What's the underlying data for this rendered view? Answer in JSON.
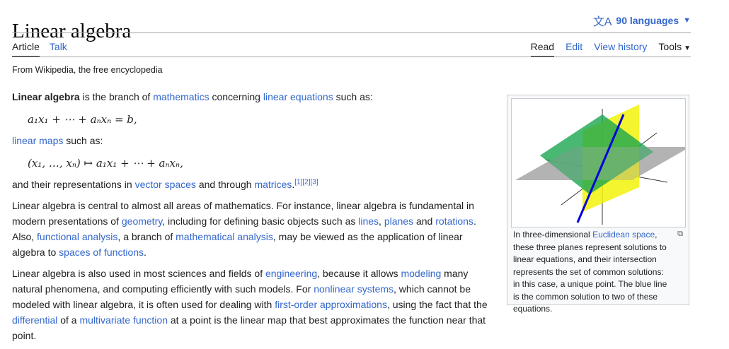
{
  "page": {
    "title": "Linear algebra",
    "languages_label": "90 languages",
    "tagline": "From Wikipedia, the free encyclopedia"
  },
  "tabs": {
    "article": "Article",
    "talk": "Talk",
    "read": "Read",
    "edit": "Edit",
    "view_history": "View history",
    "tools": "Tools"
  },
  "content": {
    "p1": {
      "bold": "Linear algebra",
      "t1": " is the branch of ",
      "l1": "mathematics",
      "t2": " concerning ",
      "l2": "linear equations",
      "t3": " such as:"
    },
    "math1": "a₁x₁ + ⋯ + aₙxₙ = b,",
    "p2": {
      "l1": "linear maps",
      "t1": " such as:"
    },
    "math2": "(x₁, …, xₙ) ↦ a₁x₁ + ⋯ + aₙxₙ,",
    "p3": {
      "t1": "and their representations in ",
      "l1": "vector spaces",
      "t2": " and through ",
      "l2": "matrices",
      "t3": ".",
      "refs": "[1][2][3]"
    },
    "p4": {
      "t1": "Linear algebra is central to almost all areas of mathematics. For instance, linear algebra is fundamental in modern presentations of ",
      "l1": "geometry",
      "t2": ", including for defining basic objects such as ",
      "l2": "lines",
      "t3": ", ",
      "l3": "planes",
      "t4": " and ",
      "l4": "rotations",
      "t5": ". Also, ",
      "l5": "functional analysis",
      "t6": ", a branch of ",
      "l6": "mathematical analysis",
      "t7": ", may be viewed as the application of linear algebra to ",
      "l7": "spaces of functions",
      "t8": "."
    },
    "p5": {
      "t1": "Linear algebra is also used in most sciences and fields of ",
      "l1": "engineering",
      "t2": ", because it allows ",
      "l2": "modeling",
      "t3": " many natural phenomena, and computing efficiently with such models. For ",
      "l3": "nonlinear systems",
      "t4": ", which cannot be modeled with linear algebra, it is often used for dealing with ",
      "l4": "first-order approximations",
      "t5": ", using the fact that the ",
      "l5": "differential",
      "t6": " of a ",
      "l6": "multivariate function",
      "t7": " at a point is the linear map that best approximates the function near that point."
    }
  },
  "infobox": {
    "caption_t1": "In three-dimensional ",
    "caption_l1": "Euclidean space",
    "caption_t2": ", these three planes represent solutions to linear equations, and their intersection represents the set of common solutions: in this case, a unique point. The blue line is the common solution to two of these equations.",
    "enlarge_icon": "enlarge-icon"
  },
  "colors": {
    "link": "#3366cc",
    "text": "#202122",
    "green_plane": "#1aa650",
    "yellow_plane": "#f2f20a",
    "gray_plane": "#9c9c9c",
    "blue_line": "#0000dd"
  }
}
